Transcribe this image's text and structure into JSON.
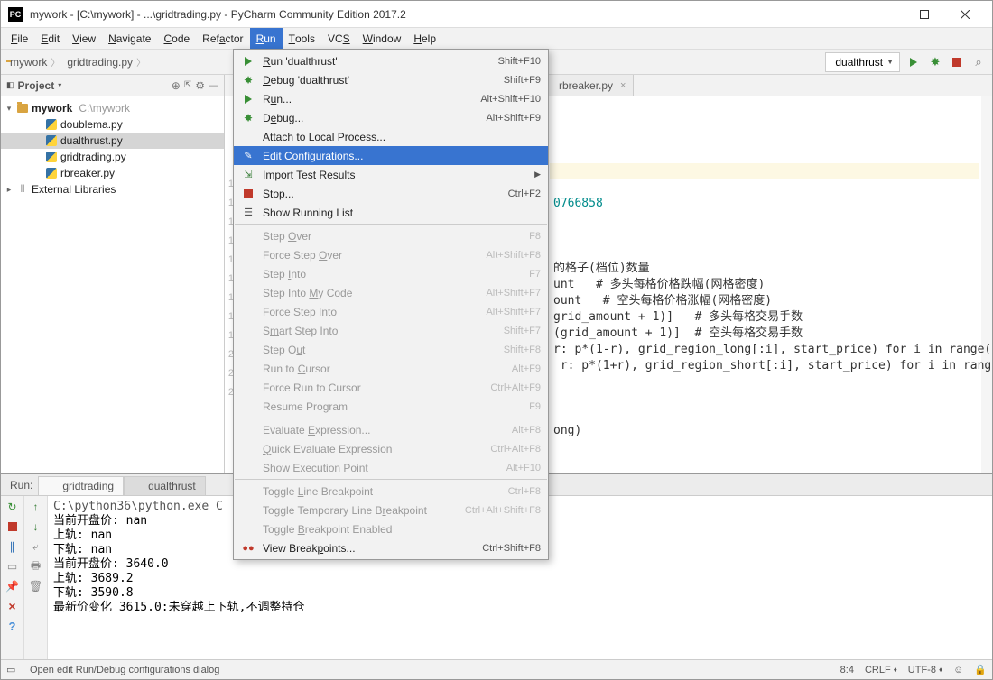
{
  "titlebar": {
    "title": "mywork - [C:\\mywork] - ...\\gridtrading.py - PyCharm Community Edition 2017.2"
  },
  "menubar": {
    "items": [
      {
        "label": "File",
        "u": 0
      },
      {
        "label": "Edit",
        "u": 0
      },
      {
        "label": "View",
        "u": 0
      },
      {
        "label": "Navigate",
        "u": 0
      },
      {
        "label": "Code",
        "u": 0
      },
      {
        "label": "Refactor",
        "u": 3
      },
      {
        "label": "Run",
        "u": 0,
        "active": true
      },
      {
        "label": "Tools",
        "u": 0
      },
      {
        "label": "VCS",
        "u": 2
      },
      {
        "label": "Window",
        "u": 0
      },
      {
        "label": "Help",
        "u": 0
      }
    ]
  },
  "breadcrumb": {
    "items": [
      "mywork",
      "gridtrading.py"
    ]
  },
  "run_config": {
    "name": "dualthrust"
  },
  "project": {
    "title": "Project",
    "root": {
      "name": "mywork",
      "hint": "C:\\mywork"
    },
    "files": [
      "doublema.py",
      "dualthrust.py",
      "gridtrading.py",
      "rbreaker.py"
    ],
    "selected": "dualthrust.py",
    "ext_lib": "External Libraries"
  },
  "editor": {
    "tabs": [
      "rbreaker.py"
    ],
    "code": [
      {
        "cls": "",
        "t": ""
      },
      {
        "cls": "",
        "t": ""
      },
      {
        "cls": "",
        "t": ""
      },
      {
        "cls": "code-bg-hl",
        "t": ""
      },
      {
        "cls": "",
        "t": ""
      },
      {
        "cls": "hl-cyan",
        "t": "0766858"
      },
      {
        "cls": "",
        "t": ""
      },
      {
        "cls": "",
        "t": ""
      },
      {
        "cls": "",
        "t": ""
      },
      {
        "cls": "",
        "t": "的格子(档位)数量"
      },
      {
        "cls": "",
        "t": "unt   # 多头每格价格跌幅(网格密度)"
      },
      {
        "cls": "",
        "t": "ount   # 空头每格价格涨幅(网格密度)"
      },
      {
        "cls": "",
        "t": "grid_amount + 1)]   # 多头每格交易手数"
      },
      {
        "cls": "",
        "t": "(grid_amount + 1)]  # 空头每格交易手数"
      },
      {
        "cls": "",
        "t": "r: p*(1-r), grid_region_long[:i], start_price) for i in range("
      },
      {
        "cls": "",
        "t": " r: p*(1+r), grid_region_short[:i], start_price) for i in rang"
      },
      {
        "cls": "",
        "t": ""
      },
      {
        "cls": "",
        "t": ""
      },
      {
        "cls": "",
        "t": ""
      },
      {
        "cls": "",
        "t": "ong)"
      }
    ]
  },
  "dropdown": {
    "groups": [
      [
        {
          "icon": "play",
          "label": "Run 'dualthrust'",
          "u": 0,
          "short": "Shift+F10"
        },
        {
          "icon": "bug",
          "label": "Debug 'dualthrust'",
          "u": 0,
          "short": "Shift+F9"
        },
        {
          "icon": "play",
          "label": "Run...",
          "u": 1,
          "short": "Alt+Shift+F10"
        },
        {
          "icon": "bug",
          "label": "Debug...",
          "u": 1,
          "short": "Alt+Shift+F9"
        },
        {
          "icon": "",
          "label": "Attach to Local Process...",
          "u": -1,
          "short": ""
        },
        {
          "icon": "edit",
          "label": "Edit Configurations...",
          "u": 8,
          "highlight": true,
          "short": ""
        },
        {
          "icon": "import",
          "label": "Import Test Results",
          "u": -1,
          "short": "",
          "submenu": true
        },
        {
          "icon": "stop",
          "label": "Stop...",
          "u": -1,
          "short": "Ctrl+F2"
        },
        {
          "icon": "list",
          "label": "Show Running List",
          "u": -1,
          "short": ""
        }
      ],
      [
        {
          "icon": "",
          "label": "Step Over",
          "u": 5,
          "short": "F8",
          "disabled": true
        },
        {
          "icon": "",
          "label": "Force Step Over",
          "u": 11,
          "short": "Alt+Shift+F8",
          "disabled": true
        },
        {
          "icon": "",
          "label": "Step Into",
          "u": 5,
          "short": "F7",
          "disabled": true
        },
        {
          "icon": "",
          "label": "Step Into My Code",
          "u": 10,
          "short": "Alt+Shift+F7",
          "disabled": true
        },
        {
          "icon": "",
          "label": "Force Step Into",
          "u": 0,
          "short": "Alt+Shift+F7",
          "disabled": true
        },
        {
          "icon": "",
          "label": "Smart Step Into",
          "u": 1,
          "short": "Shift+F7",
          "disabled": true
        },
        {
          "icon": "",
          "label": "Step Out",
          "u": 6,
          "short": "Shift+F8",
          "disabled": true
        },
        {
          "icon": "",
          "label": "Run to Cursor",
          "u": 7,
          "short": "Alt+F9",
          "disabled": true
        },
        {
          "icon": "",
          "label": "Force Run to Cursor",
          "u": -1,
          "short": "Ctrl+Alt+F9",
          "disabled": true
        },
        {
          "icon": "",
          "label": "Resume Program",
          "u": -1,
          "short": "F9",
          "disabled": true
        }
      ],
      [
        {
          "icon": "",
          "label": "Evaluate Expression...",
          "u": 9,
          "short": "Alt+F8",
          "disabled": true
        },
        {
          "icon": "",
          "label": "Quick Evaluate Expression",
          "u": 0,
          "short": "Ctrl+Alt+F8",
          "disabled": true
        },
        {
          "icon": "",
          "label": "Show Execution Point",
          "u": 6,
          "short": "Alt+F10",
          "disabled": true
        }
      ],
      [
        {
          "icon": "",
          "label": "Toggle Line Breakpoint",
          "u": 7,
          "short": "Ctrl+F8",
          "disabled": true
        },
        {
          "icon": "",
          "label": "Toggle Temporary Line Breakpoint",
          "u": 23,
          "short": "Ctrl+Alt+Shift+F8",
          "disabled": true
        },
        {
          "icon": "",
          "label": "Toggle Breakpoint Enabled",
          "u": 7,
          "short": "",
          "disabled": true
        },
        {
          "icon": "bp",
          "label": "View Breakpoints...",
          "u": 10,
          "short": "Ctrl+Shift+F8"
        }
      ]
    ]
  },
  "run_panel": {
    "label": "Run:",
    "tabs": [
      "gridtrading",
      "dualthrust"
    ],
    "active_tab": 1,
    "lines": [
      "C:\\python36\\python.exe C",
      "当前开盘价: nan",
      "上轨: nan",
      "下轨: nan",
      "当前开盘价: 3640.0",
      "上轨: 3689.2",
      "下轨: 3590.8",
      "最新价变化 3615.0:未穿越上下轨,不调整持仓"
    ]
  },
  "statusbar": {
    "hint": "Open edit Run/Debug configurations dialog",
    "pos": "8:4",
    "lineend": "CRLF",
    "encoding": "UTF-8"
  }
}
